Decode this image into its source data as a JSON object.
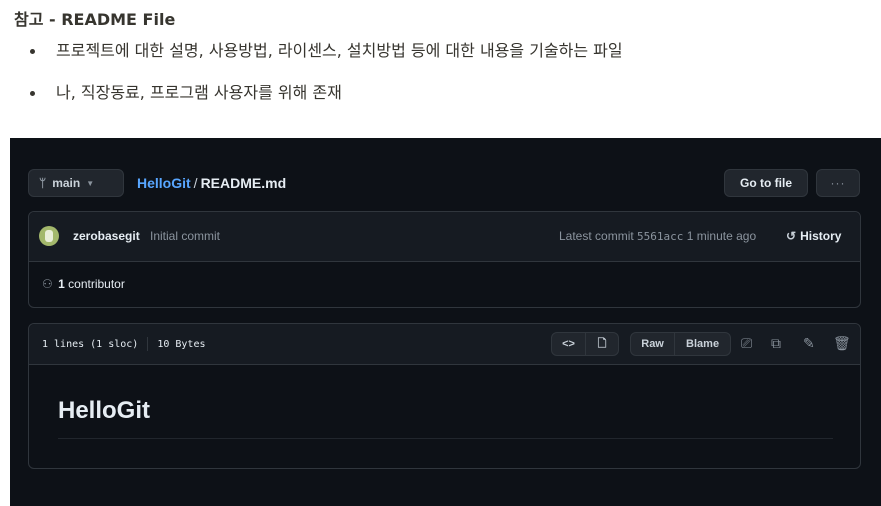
{
  "note": {
    "title": "참고 - README File",
    "bullets": [
      "프로젝트에 대한 설명, 사용방법, 라이센스, 설치방법 등에 대한 내용을 기술하는 파일",
      "나, 직장동료, 프로그램 사용자를 위해 존재"
    ]
  },
  "github": {
    "branch": "main",
    "repo": "HelloGit",
    "separator": "/",
    "file": "README.md",
    "go_to_file_label": "Go to file",
    "more_label": "···",
    "commit": {
      "author": "zerobasegit",
      "message": "Initial commit",
      "latest_label": "Latest commit",
      "sha": "5561acc",
      "time": "1 minute ago",
      "history_label": "History"
    },
    "contributors": {
      "count": "1",
      "label": "contributor"
    },
    "file_info": {
      "lines": "1 lines (1 sloc)",
      "size": "10 Bytes"
    },
    "buttons": {
      "code_view": "<>",
      "raw": "Raw",
      "blame": "Blame"
    },
    "readme_heading": "HelloGit"
  },
  "colors": {
    "background": "#0d1117",
    "panel": "#161b22",
    "border": "#30363d",
    "link": "#58a6ff",
    "muted": "#8b949e"
  },
  "icons": [
    "branch-icon",
    "caret-down-icon",
    "avatar",
    "history-icon",
    "people-icon",
    "code-icon",
    "file-icon",
    "desktop-icon",
    "copy-icon",
    "pencil-icon",
    "trash-icon"
  ]
}
